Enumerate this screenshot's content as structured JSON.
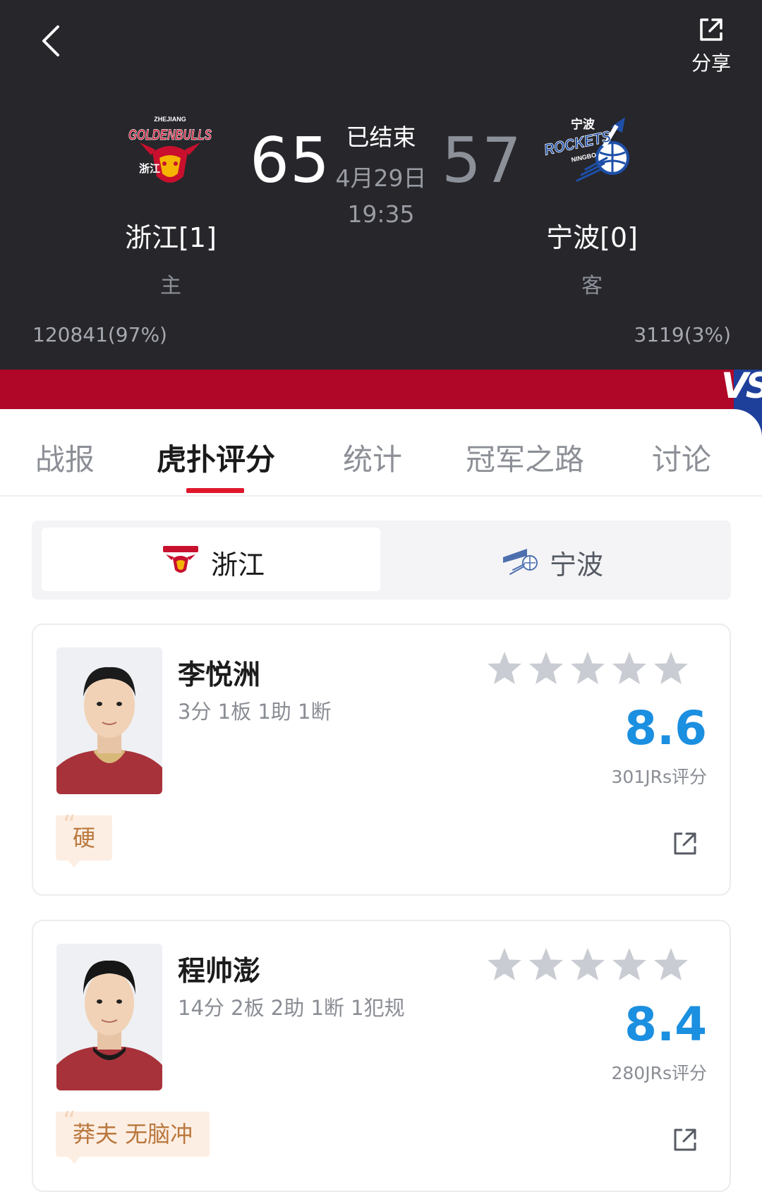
{
  "header": {
    "share_label": "分享",
    "status": "已结束",
    "date": "4月29日",
    "time": "19:35",
    "home": {
      "name": "浙江[1]",
      "role": "主",
      "score": "65",
      "support": "120841(97%)",
      "logo_icon": "golden-bulls-logo",
      "logo_text_top": "ZHEJIANG",
      "logo_text_main": "GOLDENBULLS",
      "logo_text_cn": "浙江"
    },
    "away": {
      "name": "宁波[0]",
      "role": "客",
      "score": "57",
      "support": "3119(3%)",
      "logo_icon": "rockets-logo",
      "logo_text_cn": "宁波",
      "logo_text_main": "ROCKETS",
      "logo_text_sub": "NINGBO"
    },
    "vs_label": "VS"
  },
  "tabs": [
    {
      "label": "战报",
      "active": false
    },
    {
      "label": "虎扑评分",
      "active": true
    },
    {
      "label": "统计",
      "active": false
    },
    {
      "label": "冠军之路",
      "active": false
    },
    {
      "label": "讨论",
      "active": false
    }
  ],
  "team_switch": {
    "home_label": "浙江",
    "away_label": "宁波",
    "selected": "浙江"
  },
  "players": [
    {
      "name": "李悦洲",
      "stats": "3分 1板 1助 1断",
      "rating": "8.6",
      "rating_count": "301JRs评分",
      "tag": "硬",
      "stars_filled": 0
    },
    {
      "name": "程帅澎",
      "stats": "14分 2板 2助 1断 1犯规",
      "rating": "8.4",
      "rating_count": "280JRs评分",
      "tag": "莽夫 无脑冲",
      "stars_filled": 0
    }
  ],
  "colors": {
    "header_bg": "#26262b",
    "accent_red": "#e0172c",
    "band_red": "#b00628",
    "rating_blue": "#1b8fe0",
    "tag_bg": "#fdeee3",
    "tag_text": "#b9783e",
    "star_empty": "#c9ccd2"
  }
}
